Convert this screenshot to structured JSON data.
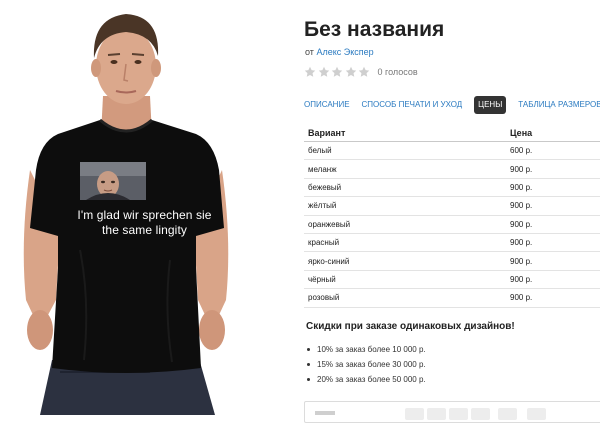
{
  "product": {
    "title": "Без названия",
    "author_prefix": "от",
    "author_name": "Алекс Экспер",
    "rating_count": "0 голосов",
    "image": {
      "print_caption_line1": "I'm glad wir sprechen sie",
      "print_caption_line2": "the same lingity",
      "shirt_color": "#0d0d0d"
    }
  },
  "tabs": [
    {
      "label": "ОПИСАНИЕ",
      "active": false
    },
    {
      "label": "СПОСОБ ПЕЧАТИ И УХОД",
      "active": false
    },
    {
      "label": "ЦЕНЫ",
      "active": true
    },
    {
      "label": "ТАБЛИЦА РАЗМЕРОВ",
      "active": false
    }
  ],
  "price_table": {
    "headers": [
      "Вариант",
      "Цена"
    ],
    "rows": [
      {
        "variant": "белый",
        "price": "600 р."
      },
      {
        "variant": "меланж",
        "price": "900 р."
      },
      {
        "variant": "бежевый",
        "price": "900 р."
      },
      {
        "variant": "жёлтый",
        "price": "900 р."
      },
      {
        "variant": "оранжевый",
        "price": "900 р."
      },
      {
        "variant": "красный",
        "price": "900 р."
      },
      {
        "variant": "ярко-синий",
        "price": "900 р."
      },
      {
        "variant": "чёрный",
        "price": "900 р."
      },
      {
        "variant": "розовый",
        "price": "900 р."
      }
    ]
  },
  "discounts": {
    "title": "Скидки при заказе одинаковых дизайнов!",
    "items": [
      "10% за заказ более 10 000 р.",
      "15% за заказ более 30 000 р.",
      "20% за заказ более 50 000 р."
    ]
  },
  "colors": {
    "link": "#2a7ac0",
    "active_tab_bg": "#333333",
    "star": "#cfcfcf"
  }
}
